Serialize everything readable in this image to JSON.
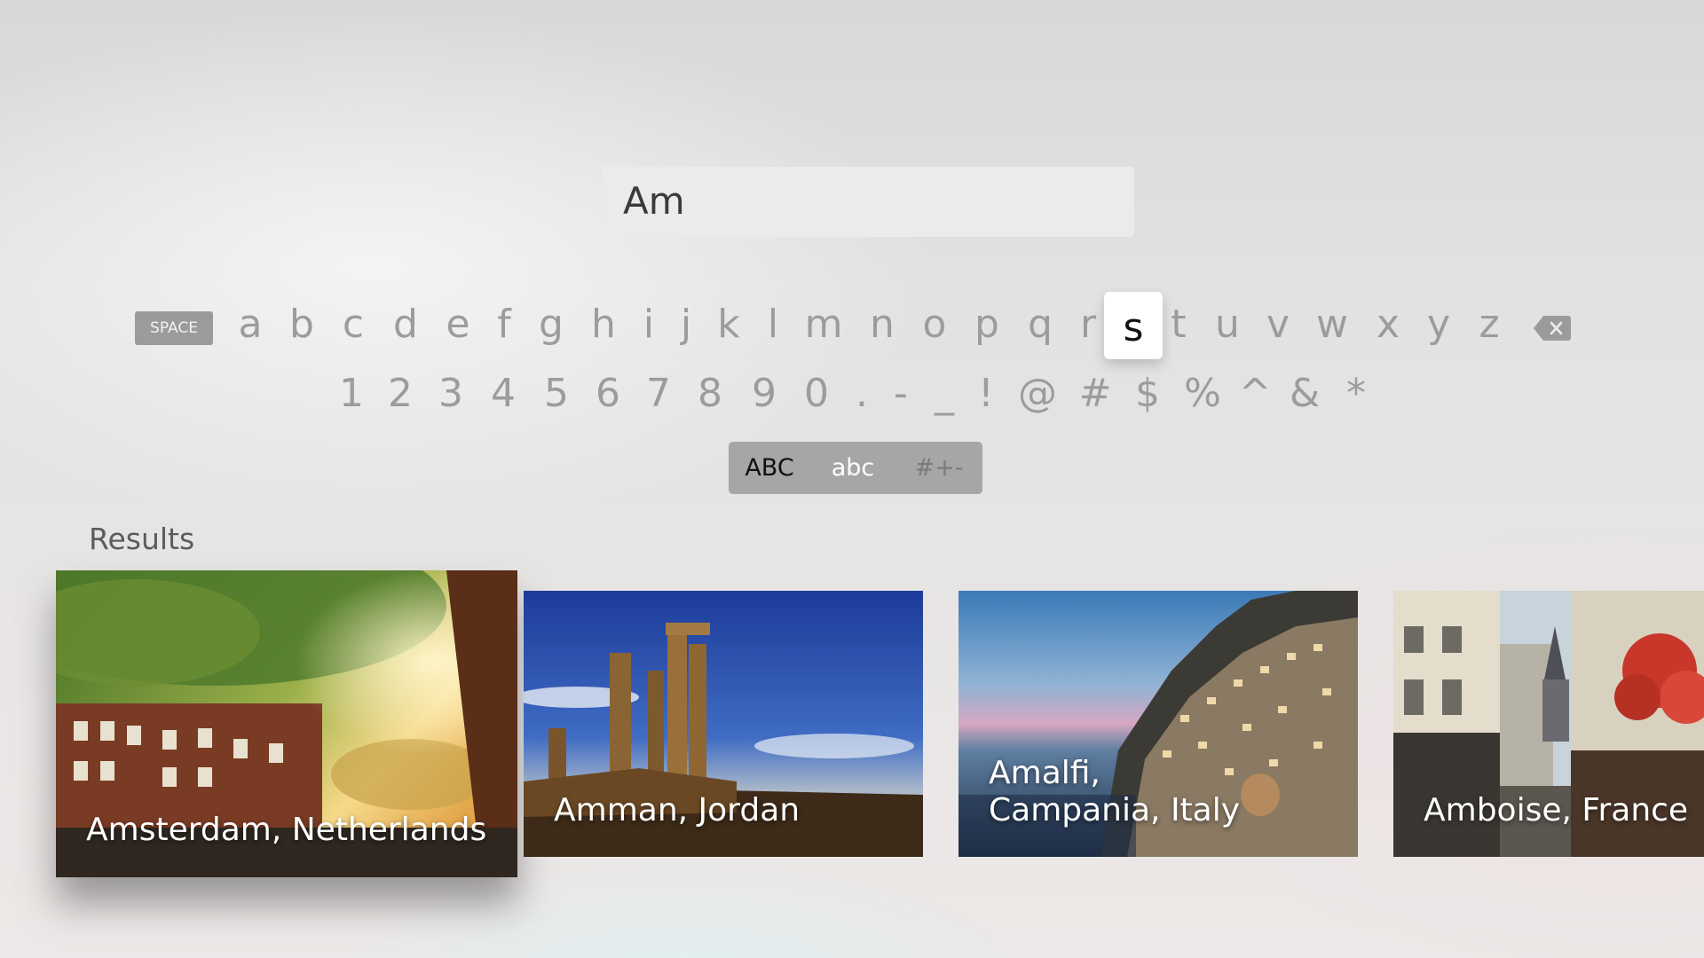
{
  "search": {
    "query": "Am"
  },
  "keyboard": {
    "space_label": "SPACE",
    "letters": [
      "a",
      "b",
      "c",
      "d",
      "e",
      "f",
      "g",
      "h",
      "i",
      "j",
      "k",
      "l",
      "m",
      "n",
      "o",
      "p",
      "q",
      "r",
      "s",
      "t",
      "u",
      "v",
      "w",
      "x",
      "y",
      "z"
    ],
    "focused_key": "s",
    "symbols": [
      "1",
      "2",
      "3",
      "4",
      "5",
      "6",
      "7",
      "8",
      "9",
      "0",
      ".",
      "-",
      "_",
      "!",
      "@",
      "#",
      "$",
      "%",
      "^",
      "&",
      "*"
    ],
    "backspace_icon": "backspace-icon",
    "modes": [
      {
        "label": "ABC",
        "state": "selected"
      },
      {
        "label": "abc",
        "state": "active"
      },
      {
        "label": "#+-",
        "state": "inactive"
      }
    ]
  },
  "results": {
    "label": "Results",
    "items": [
      {
        "caption": "Amsterdam, Netherlands",
        "focused": true
      },
      {
        "caption": "Amman, Jordan"
      },
      {
        "caption": "Amalfi,\nCampania, Italy"
      },
      {
        "caption": "Amboise, France"
      }
    ]
  }
}
